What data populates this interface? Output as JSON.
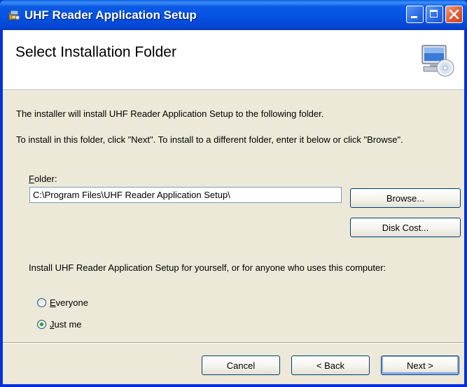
{
  "window": {
    "title": "UHF Reader Application Setup",
    "title_icon": "installer-icon",
    "controls": [
      "minimize-icon",
      "maximize-icon",
      "close-icon"
    ]
  },
  "banner": {
    "title": "Select Installation Folder",
    "icon": "computer-cd-icon"
  },
  "body": {
    "intro": "The installer will install UHF Reader Application Setup to the following folder.",
    "instructions": "To install in this folder, click \"Next\". To install to a different folder, enter it below or click \"Browse\".",
    "folder_label_accesskey": "F",
    "folder_label_rest": "older:",
    "folder_value": "C:\\Program Files\\UHF Reader Application Setup\\",
    "browse_label": "Browse...",
    "disk_cost_label": "Disk Cost...",
    "install_for_prompt": "Install UHF Reader Application Setup for yourself, or for anyone who uses this computer:",
    "options": [
      {
        "accesskey": "E",
        "rest": "veryone",
        "selected": false
      },
      {
        "accesskey": "J",
        "rest": "ust me",
        "selected": true
      }
    ]
  },
  "footer": {
    "cancel_label": "Cancel",
    "back_label": "< Back",
    "next_label": "Next >"
  },
  "colors": {
    "titlebar": "#0553e1",
    "dialog_bg": "#ece9d8",
    "close_button": "#e35a32",
    "radio_dot": "#21a121"
  }
}
